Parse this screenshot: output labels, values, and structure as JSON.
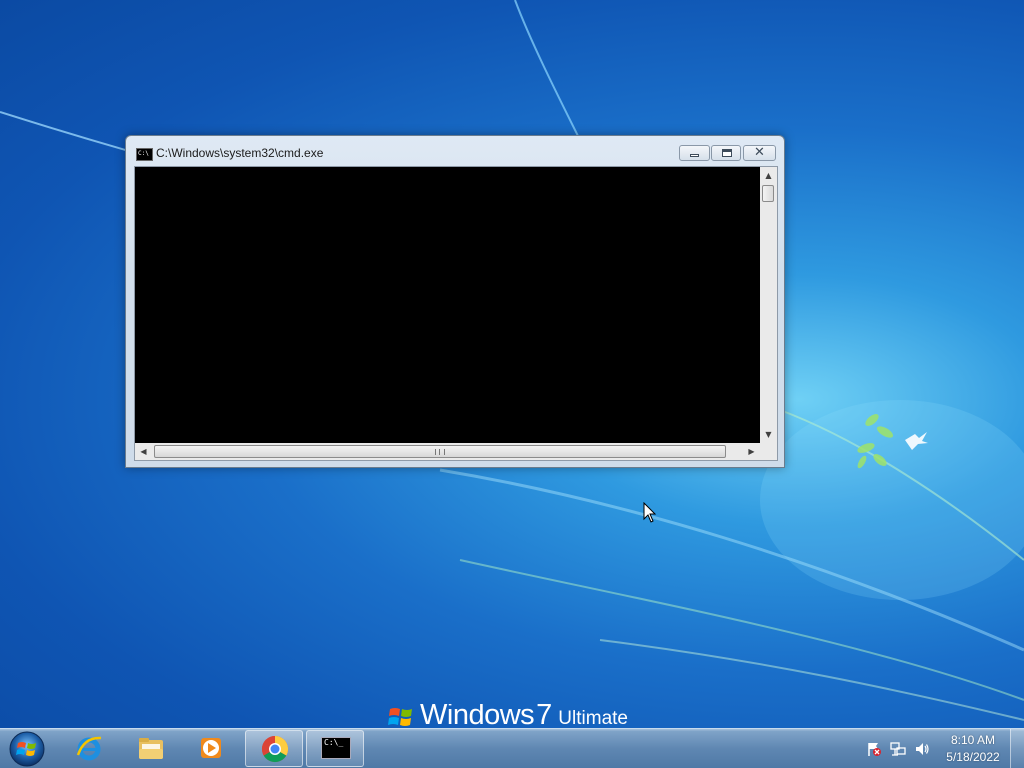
{
  "desktop": {
    "branding": {
      "name": "Windows",
      "version": "7",
      "edition": "Ultimate"
    }
  },
  "cmd_window": {
    "title": "C:\\Windows\\system32\\cmd.exe",
    "icon_text": "C:\\",
    "controls": {
      "minimize_icon": "minimize-icon",
      "maximize_icon": "maximize-icon",
      "close_icon": "close-icon"
    },
    "console_text": ""
  },
  "taskbar": {
    "items": [
      {
        "name": "internet-explorer-icon",
        "active": false
      },
      {
        "name": "windows-explorer-icon",
        "active": false
      },
      {
        "name": "windows-media-player-icon",
        "active": false
      },
      {
        "name": "chrome-icon",
        "active": true
      },
      {
        "name": "cmd-icon",
        "active": true,
        "icon_text": "C:\\_"
      }
    ],
    "tray": {
      "icons": [
        "action-center-icon",
        "network-icon",
        "volume-icon"
      ],
      "time": "8:10 AM",
      "date": "5/18/2022"
    }
  },
  "colors": {
    "desktop_blue": "#1a6fc9",
    "console_background": "#000000",
    "taskbar": "#5f87b2"
  }
}
